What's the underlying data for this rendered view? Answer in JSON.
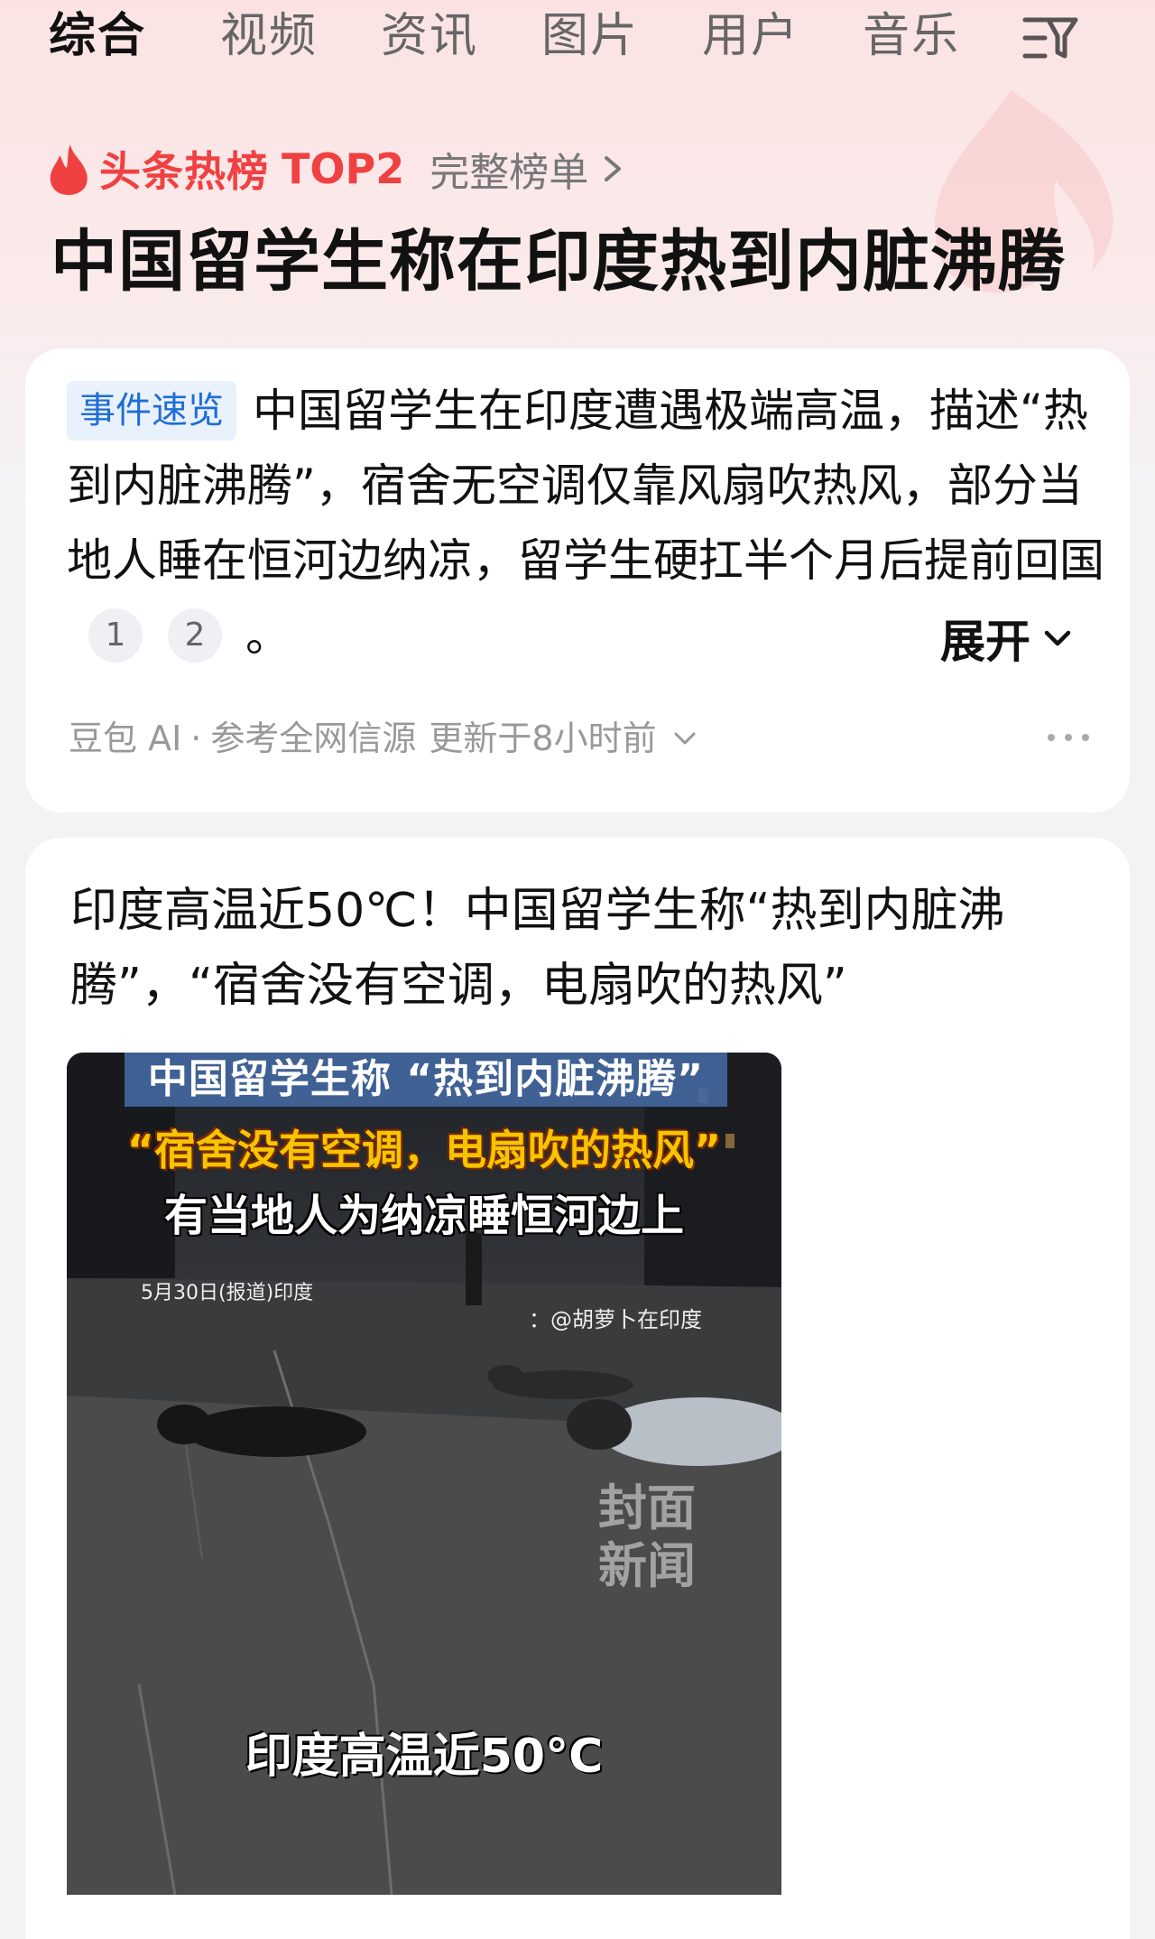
{
  "tabs": [
    {
      "label": "综合",
      "active": true
    },
    {
      "label": "视频",
      "active": false
    },
    {
      "label": "资讯",
      "active": false
    },
    {
      "label": "图片",
      "active": false
    },
    {
      "label": "用户",
      "active": false
    },
    {
      "label": "音乐",
      "active": false
    }
  ],
  "filter_icon": "filter-icon",
  "hot": {
    "label": "头条热榜",
    "rank": "TOP2",
    "full_list": "完整榜单",
    "icon": "fire-icon",
    "accent_color": "#f04142"
  },
  "topic_title": "中国留学生称在印度热到内脏沸腾",
  "summary": {
    "badge": "事件速览",
    "text": "中国留学生在印度遭遇极端高温，描述“热到内脏沸腾”，宿舍无空调仅靠风扇吹热风，部分当地人睡在恒河边纳凉，留学生硬扛半个月后提前回国",
    "citations": [
      "1",
      "2"
    ],
    "end_punct": "。",
    "expand_label": "展开",
    "source": "豆包 AI",
    "separator": "·",
    "reference": "参考全网信源",
    "updated": "更新于8小时前",
    "badge_color": "#1f6dd6"
  },
  "news": {
    "title": "印度高温近50℃！中国留学生称“热到内脏沸腾”，“宿舍没有空调，电扇吹的热风”",
    "thumbnail": {
      "caption_top": "中国留学生称 “热到内脏沸腾”",
      "caption_yellow": "“宿舍没有空调，电扇吹的热风”",
      "caption_white": "有当地人为纳凉睡恒河边上",
      "date_tag": "5月30日(报道)印度",
      "author_tag": "：@胡萝卜在印度",
      "watermark": "封面新闻",
      "caption_bottom": "印度高温近50°C"
    }
  }
}
